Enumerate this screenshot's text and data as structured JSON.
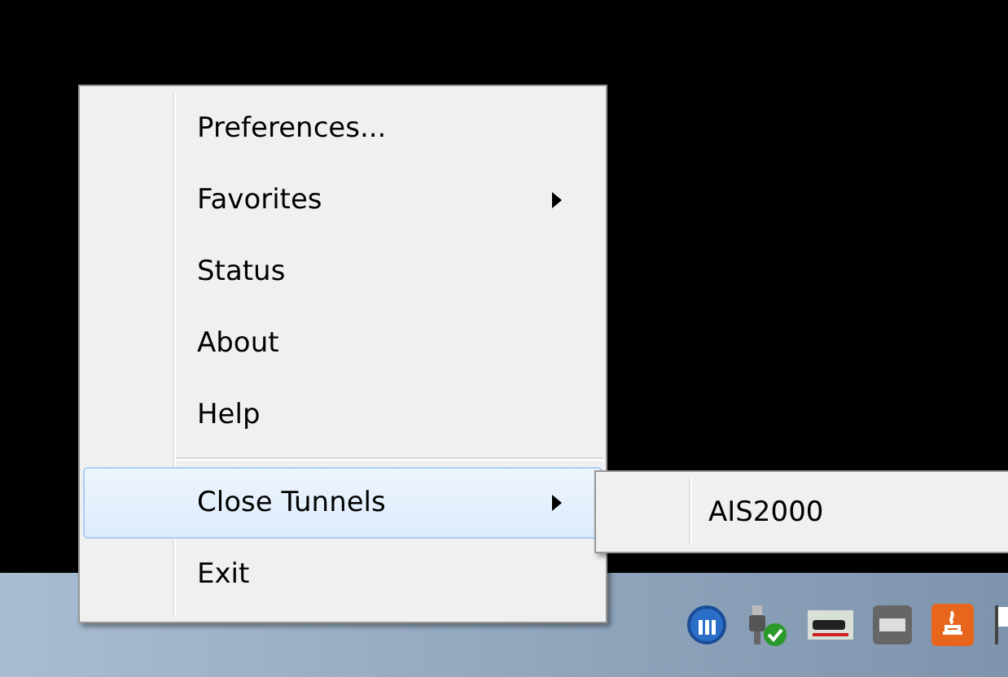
{
  "context_menu": {
    "items": [
      {
        "kind": "item",
        "label": "Preferences...",
        "has_submenu": false,
        "selected": false
      },
      {
        "kind": "item",
        "label": "Favorites",
        "has_submenu": true,
        "selected": false
      },
      {
        "kind": "item",
        "label": "Status",
        "has_submenu": false,
        "selected": false
      },
      {
        "kind": "item",
        "label": "About",
        "has_submenu": false,
        "selected": false
      },
      {
        "kind": "item",
        "label": "Help",
        "has_submenu": false,
        "selected": false
      },
      {
        "kind": "separator"
      },
      {
        "kind": "item",
        "label": "Close Tunnels",
        "has_submenu": true,
        "selected": true
      },
      {
        "kind": "item",
        "label": "Exit",
        "has_submenu": false,
        "selected": false
      }
    ]
  },
  "submenu": {
    "items": [
      {
        "label": "AIS2000",
        "selected": false
      }
    ]
  }
}
